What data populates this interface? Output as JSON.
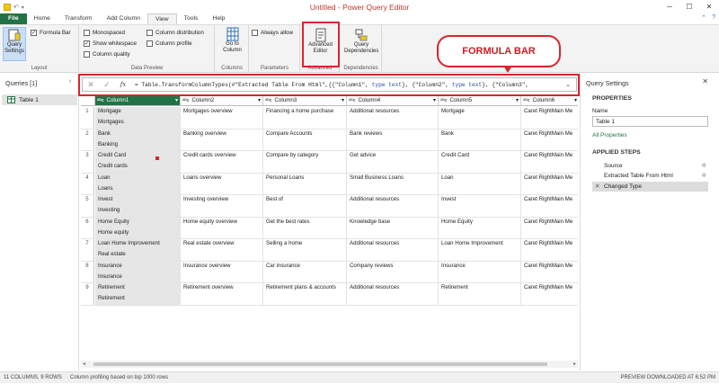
{
  "window": {
    "title": "Untitled - Power Query Editor",
    "min": "─",
    "max": "☐",
    "close": "✕"
  },
  "menu_tabs": [
    {
      "label": "File"
    },
    {
      "label": "Home"
    },
    {
      "label": "Transform"
    },
    {
      "label": "Add Column"
    },
    {
      "label": "View"
    },
    {
      "label": "Tools"
    },
    {
      "label": "Help"
    }
  ],
  "ribbon": {
    "layout": {
      "query_settings": "Query Settings",
      "formula_bar": "Formula Bar",
      "group": "Layout"
    },
    "data_preview": {
      "monospaced": "Monospaced",
      "show_whitespace": "Show whitespace",
      "column_quality": "Column quality",
      "column_distribution": "Column distribution",
      "column_profile": "Column profile",
      "group": "Data Preview"
    },
    "columns": {
      "go_to_column": "Go to Column",
      "group": "Columns"
    },
    "parameters": {
      "always_allow": "Always allow",
      "group": "Parameters"
    },
    "advanced": {
      "advanced_editor": "Advanced Editor",
      "group": "Advanced"
    },
    "dependencies": {
      "query_dependencies": "Query Dependencies",
      "group": "Dependencies"
    }
  },
  "callout": {
    "text": "FORMULA BAR"
  },
  "queries": {
    "header": "Queries [1]",
    "items": [
      {
        "label": "Table 1"
      }
    ]
  },
  "formula": {
    "fx": "fx",
    "prefix": "= Table.TransformColumnTypes(#\"Extracted Table From Html\",{{\"Column1\", ",
    "kw1": "type text",
    "mid": "}, {\"Column2\", ",
    "kw2": "type text",
    "suffix": "}, {\"Column3\","
  },
  "table": {
    "columns": [
      "Column1",
      "Column2",
      "Column3",
      "Column4",
      "Column5",
      "Column6"
    ],
    "rows": [
      {
        "n": "1",
        "c1a": "Mortgage",
        "c1b": "Mortgages",
        "c2": "Mortgages overview",
        "c3": "Financing a home purchase",
        "c4": "Additional resources",
        "c5": "Mortgage",
        "c6": "Caret RightMain Me"
      },
      {
        "n": "2",
        "c1a": "Bank",
        "c1b": "Banking",
        "c2": "Banking overview",
        "c3": "Compare Accounts",
        "c4": "Bank reviews",
        "c5": "Bank",
        "c6": "Caret RightMain Me"
      },
      {
        "n": "3",
        "c1a": "Credit Card",
        "c1b": "Credit cards",
        "c2": "Credit cards overview",
        "c3": "Compare by category",
        "c4": "Get advice",
        "c5": "Credit Card",
        "c6": "Caret RightMain Me"
      },
      {
        "n": "4",
        "c1a": "Loan",
        "c1b": "Loans",
        "c2": "Loans overview",
        "c3": "Personal Loans",
        "c4": "Small Business Loans",
        "c5": "Loan",
        "c6": "Caret RightMain Me"
      },
      {
        "n": "5",
        "c1a": "Invest",
        "c1b": "Investing",
        "c2": "Investing overview",
        "c3": "Best of",
        "c4": "Additional resources",
        "c5": "Invest",
        "c6": "Caret RightMain Me"
      },
      {
        "n": "6",
        "c1a": "Home Equity",
        "c1b": "Home equity",
        "c2": "Home equity overview",
        "c3": "Get the best rates",
        "c4": "Knowledge base",
        "c5": "Home Equity",
        "c6": "Caret RightMain Me"
      },
      {
        "n": "7",
        "c1a": "Loan Home Improvement",
        "c1b": "Real estate",
        "c2": "Real estate overview",
        "c3": "Selling a home",
        "c4": "Additional resources",
        "c5": "Loan Home Improvement",
        "c6": "Caret RightMain Me"
      },
      {
        "n": "8",
        "c1a": "Insurance",
        "c1b": "Insurance",
        "c2": "Insurance overview",
        "c3": "Car insurance",
        "c4": "Company reviews",
        "c5": "Insurance",
        "c6": "Caret RightMain Me"
      },
      {
        "n": "9",
        "c1a": "Retirement",
        "c1b": "Retirement",
        "c2": "Retirement overview",
        "c3": "Retirement plans & accounts",
        "c4": "Additional resources",
        "c5": "Retirement",
        "c6": "Caret RightMain Me"
      }
    ]
  },
  "settings": {
    "header": "Query Settings",
    "properties": "PROPERTIES",
    "name_label": "Name",
    "name_value": "Table 1",
    "all_properties": "All Properties",
    "applied_steps": "APPLIED STEPS",
    "steps": [
      {
        "label": "Source"
      },
      {
        "label": "Extracted Table From Html"
      },
      {
        "label": "Changed Type"
      }
    ]
  },
  "status": {
    "left": "11 COLUMNS, 9 ROWS",
    "profiling": "Column profiling based on top 1000 rows",
    "right": "PREVIEW DOWNLOADED AT 6:52 PM"
  },
  "colors": {
    "accent": "#217346",
    "highlight": "#d9242b"
  }
}
